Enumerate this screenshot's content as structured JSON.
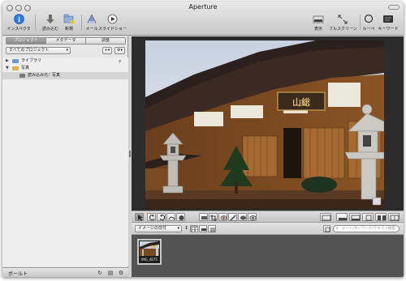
{
  "window": {
    "title": "Aperture"
  },
  "toolbar": {
    "inspector": "インスペクタ",
    "import": "読み込む",
    "new": "新規",
    "mail": "メール",
    "slideshow": "スライドショー",
    "view": "表示",
    "fullscreen": "フルスクリーン",
    "loupe": "ルーペ",
    "keywords": "キーワード"
  },
  "inspector": {
    "tabs": [
      "プロジェクト",
      "メタデータ",
      "調整"
    ],
    "active_tab": 0,
    "project_filter": "すべてのプロジェクト",
    "tree": [
      {
        "label": "ライブラリ",
        "level": 0,
        "expanded": false
      },
      {
        "label": "写真",
        "level": 0,
        "expanded": true
      },
      {
        "label": "読み込み元：写真",
        "level": 1,
        "selected": true
      }
    ],
    "footer_label": "ボールト"
  },
  "browser": {
    "sort": "イメージの日付",
    "search_placeholder": "レート/キーワード/テキスト検索",
    "thumbnails": [
      {
        "name": "IMG_4875"
      }
    ]
  },
  "colors": {
    "viewer_bg": "#2c2c2c",
    "browser_bg": "#535353",
    "sidebar_bg": "#e7e7e7"
  }
}
